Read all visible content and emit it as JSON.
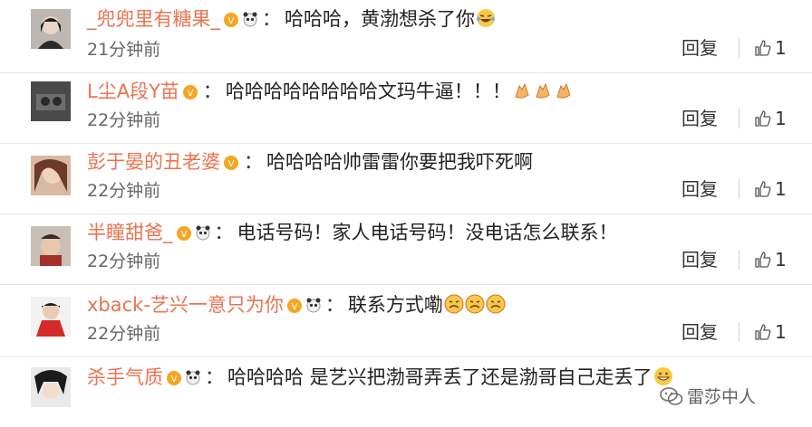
{
  "comments": [
    {
      "username": "_兜兜里有糖果_",
      "text": "哈哈哈，黄渤想杀了你",
      "emoji": [
        "laugh-cry-emoji"
      ],
      "badges": [
        "vip-badge",
        "panda-badge"
      ],
      "time": "21分钟前",
      "reply_label": "回复",
      "like_count": "1"
    },
    {
      "username": "L尘A段Y苗",
      "text": "哈哈哈哈哈哈哈哈文玛牛逼！！！",
      "emoji": [
        "clap-emoji",
        "clap-emoji",
        "clap-emoji"
      ],
      "badges": [
        "vip-badge"
      ],
      "time": "22分钟前",
      "reply_label": "回复",
      "like_count": "1"
    },
    {
      "username": "彭于晏的丑老婆",
      "text": "哈哈哈哈帅雷雷你要把我吓死啊",
      "emoji": [],
      "badges": [
        "vip-badge"
      ],
      "time": "22分钟前",
      "reply_label": "回复",
      "like_count": "1"
    },
    {
      "username": "半瞳甜爸_",
      "text": "电话号码！家人电话号码！没电话怎么联系！",
      "emoji": [],
      "badges": [
        "vip-badge",
        "panda-badge"
      ],
      "time": "22分钟前",
      "reply_label": "回复",
      "like_count": "1"
    },
    {
      "username": "xback-艺兴一意只为你",
      "text": "联系方式嘞",
      "emoji": [
        "cry-emoji",
        "cry-emoji",
        "cry-emoji"
      ],
      "badges": [
        "vip-badge",
        "panda-badge"
      ],
      "time": "22分钟前",
      "reply_label": "回复",
      "like_count": "1"
    },
    {
      "username": "杀手气质",
      "text": "哈哈哈哈 是艺兴把渤哥弄丢了还是渤哥自己走丢了",
      "emoji": [
        "grin-emoji"
      ],
      "badges": [
        "vip-badge",
        "panda-badge"
      ],
      "time": "",
      "reply_label": "",
      "like_count": ""
    }
  ],
  "watermark": "雷莎中人",
  "colors": {
    "username": "#eb7350",
    "vip_badge": "#f5a623",
    "emoji_face": "#f7c948"
  }
}
